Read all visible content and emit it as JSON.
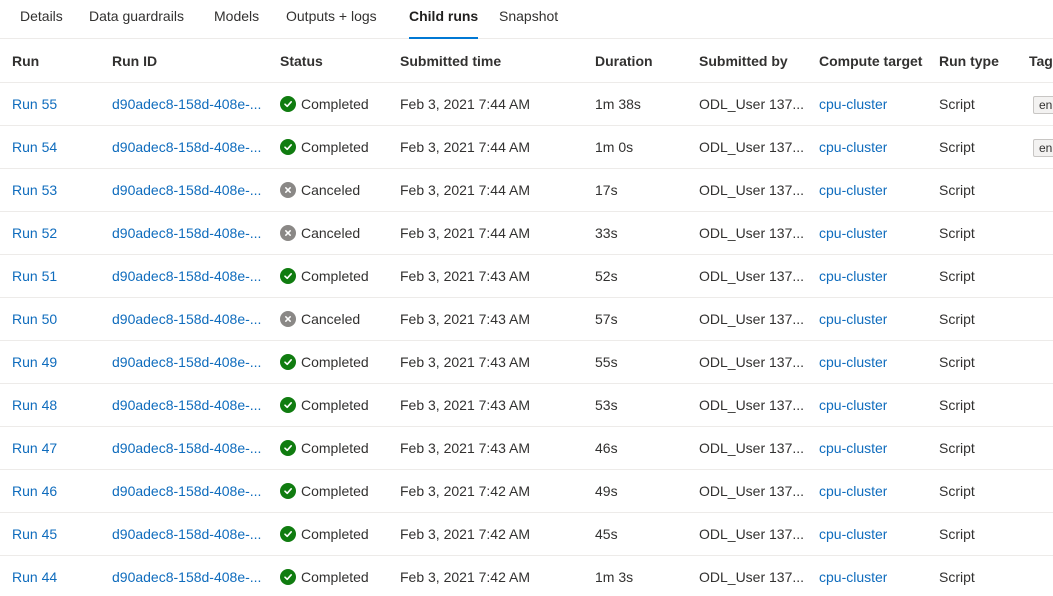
{
  "tabs": [
    {
      "label": "Details",
      "active": false
    },
    {
      "label": "Data guardrails",
      "active": false
    },
    {
      "label": "Models",
      "active": false
    },
    {
      "label": "Outputs + logs",
      "active": false
    },
    {
      "label": "Child runs",
      "active": true
    },
    {
      "label": "Snapshot",
      "active": false
    }
  ],
  "columns": [
    "Run",
    "Run ID",
    "Status",
    "Submitted time",
    "Duration",
    "Submitted by",
    "Compute target",
    "Run type",
    "Tags"
  ],
  "status_colors": {
    "Completed": "#107c10",
    "Canceled": "#8a8886"
  },
  "status_icons": {
    "Completed": "check-circle-icon",
    "Canceled": "cancel-circle-icon"
  },
  "rows": [
    {
      "run": "Run 55",
      "run_id": "d90adec8-158d-408e-...",
      "status": "Completed",
      "submitted_time": "Feb 3, 2021 7:44 AM",
      "duration": "1m 38s",
      "submitted_by": "ODL_User 137...",
      "compute_target": "cpu-cluster",
      "run_type": "Script",
      "tag": "en"
    },
    {
      "run": "Run 54",
      "run_id": "d90adec8-158d-408e-...",
      "status": "Completed",
      "submitted_time": "Feb 3, 2021 7:44 AM",
      "duration": "1m 0s",
      "submitted_by": "ODL_User 137...",
      "compute_target": "cpu-cluster",
      "run_type": "Script",
      "tag": "en"
    },
    {
      "run": "Run 53",
      "run_id": "d90adec8-158d-408e-...",
      "status": "Canceled",
      "submitted_time": "Feb 3, 2021 7:44 AM",
      "duration": "17s",
      "submitted_by": "ODL_User 137...",
      "compute_target": "cpu-cluster",
      "run_type": "Script",
      "tag": ""
    },
    {
      "run": "Run 52",
      "run_id": "d90adec8-158d-408e-...",
      "status": "Canceled",
      "submitted_time": "Feb 3, 2021 7:44 AM",
      "duration": "33s",
      "submitted_by": "ODL_User 137...",
      "compute_target": "cpu-cluster",
      "run_type": "Script",
      "tag": ""
    },
    {
      "run": "Run 51",
      "run_id": "d90adec8-158d-408e-...",
      "status": "Completed",
      "submitted_time": "Feb 3, 2021 7:43 AM",
      "duration": "52s",
      "submitted_by": "ODL_User 137...",
      "compute_target": "cpu-cluster",
      "run_type": "Script",
      "tag": ""
    },
    {
      "run": "Run 50",
      "run_id": "d90adec8-158d-408e-...",
      "status": "Canceled",
      "submitted_time": "Feb 3, 2021 7:43 AM",
      "duration": "57s",
      "submitted_by": "ODL_User 137...",
      "compute_target": "cpu-cluster",
      "run_type": "Script",
      "tag": ""
    },
    {
      "run": "Run 49",
      "run_id": "d90adec8-158d-408e-...",
      "status": "Completed",
      "submitted_time": "Feb 3, 2021 7:43 AM",
      "duration": "55s",
      "submitted_by": "ODL_User 137...",
      "compute_target": "cpu-cluster",
      "run_type": "Script",
      "tag": ""
    },
    {
      "run": "Run 48",
      "run_id": "d90adec8-158d-408e-...",
      "status": "Completed",
      "submitted_time": "Feb 3, 2021 7:43 AM",
      "duration": "53s",
      "submitted_by": "ODL_User 137...",
      "compute_target": "cpu-cluster",
      "run_type": "Script",
      "tag": ""
    },
    {
      "run": "Run 47",
      "run_id": "d90adec8-158d-408e-...",
      "status": "Completed",
      "submitted_time": "Feb 3, 2021 7:43 AM",
      "duration": "46s",
      "submitted_by": "ODL_User 137...",
      "compute_target": "cpu-cluster",
      "run_type": "Script",
      "tag": ""
    },
    {
      "run": "Run 46",
      "run_id": "d90adec8-158d-408e-...",
      "status": "Completed",
      "submitted_time": "Feb 3, 2021 7:42 AM",
      "duration": "49s",
      "submitted_by": "ODL_User 137...",
      "compute_target": "cpu-cluster",
      "run_type": "Script",
      "tag": ""
    },
    {
      "run": "Run 45",
      "run_id": "d90adec8-158d-408e-...",
      "status": "Completed",
      "submitted_time": "Feb 3, 2021 7:42 AM",
      "duration": "45s",
      "submitted_by": "ODL_User 137...",
      "compute_target": "cpu-cluster",
      "run_type": "Script",
      "tag": ""
    },
    {
      "run": "Run 44",
      "run_id": "d90adec8-158d-408e-...",
      "status": "Completed",
      "submitted_time": "Feb 3, 2021 7:42 AM",
      "duration": "1m 3s",
      "submitted_by": "ODL_User 137...",
      "compute_target": "cpu-cluster",
      "run_type": "Script",
      "tag": ""
    }
  ]
}
